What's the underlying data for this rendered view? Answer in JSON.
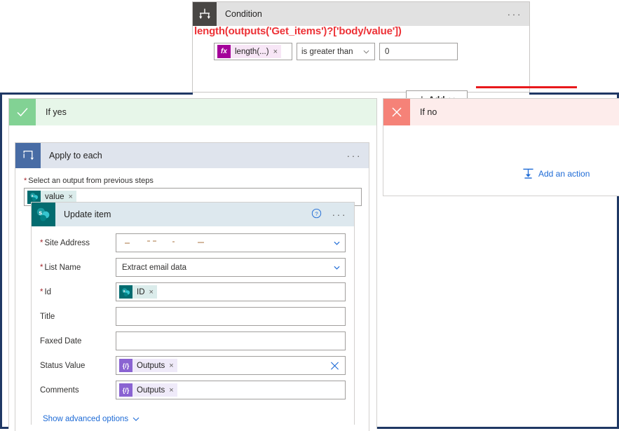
{
  "condition": {
    "icon": "condition-branch-icon",
    "title": "Condition",
    "more_label": "···",
    "annotation": "length(outputs('Get_items')?['body/value'])",
    "annotation_color": "#ed3237",
    "underline_color": "#e8191c",
    "left_operand": {
      "icon": "fx-icon",
      "icon_glyph": "fx",
      "label": "length(...)",
      "remove_label": "×",
      "color": "#a4009a"
    },
    "operator": {
      "value": "is greater than",
      "chevron": "chevron-down-icon"
    },
    "right_operand": {
      "value": "0"
    },
    "add_button": {
      "plus": "+",
      "label": "Add",
      "chevron": "chevron-down-icon"
    }
  },
  "branches": {
    "yes": {
      "badge": "checkmark-icon",
      "label": "If yes",
      "badge_color": "#82d294",
      "header_bg": "#e7f6e9"
    },
    "no": {
      "badge": "close-x-icon",
      "label": "If no",
      "badge_color": "#f58278",
      "header_bg": "#fdeceb",
      "add_action": {
        "icon": "add-an-action-icon",
        "label": "Add an action",
        "color": "#1e6bd6"
      }
    }
  },
  "apply_to_each": {
    "icon": "loop-icon",
    "icon_color": "#486ca5",
    "title": "Apply to each",
    "more_label": "···",
    "output_field": {
      "required": "*",
      "caption": "Select an output from previous steps",
      "token": {
        "icon": "sharepoint-icon",
        "icon_glyph": "s",
        "label": "value",
        "remove_label": "×"
      }
    }
  },
  "update_item": {
    "icon": "sharepoint-icon",
    "icon_glyph": "s",
    "icon_color": "#036c70",
    "title": "Update item",
    "help_label": "help-icon",
    "more_label": "···",
    "fields": [
      {
        "name": "site-address",
        "required": true,
        "label": "Site Address",
        "type": "dropdown-redacted",
        "value": ""
      },
      {
        "name": "list-name",
        "required": true,
        "label": "List Name",
        "type": "dropdown",
        "value": "Extract email data"
      },
      {
        "name": "id",
        "required": true,
        "label": "Id",
        "type": "token-sharepoint",
        "token_label": "ID",
        "token_glyph": "s",
        "remove_label": "×"
      },
      {
        "name": "title",
        "required": false,
        "label": "Title",
        "type": "text",
        "value": ""
      },
      {
        "name": "faxed-date",
        "required": false,
        "label": "Faxed Date",
        "type": "text",
        "value": ""
      },
      {
        "name": "status-value",
        "required": false,
        "label": "Status Value",
        "type": "token-outputs",
        "token_label": "Outputs",
        "token_glyph": "{/}",
        "remove_label": "×",
        "clear_label": "×"
      },
      {
        "name": "comments",
        "required": false,
        "label": "Comments",
        "type": "token-outputs",
        "token_label": "Outputs",
        "token_glyph": "{/}",
        "remove_label": "×"
      }
    ],
    "show_advanced": {
      "label": "Show advanced options",
      "chevron": "chevron-down-icon",
      "color": "#1e6bd6"
    }
  }
}
